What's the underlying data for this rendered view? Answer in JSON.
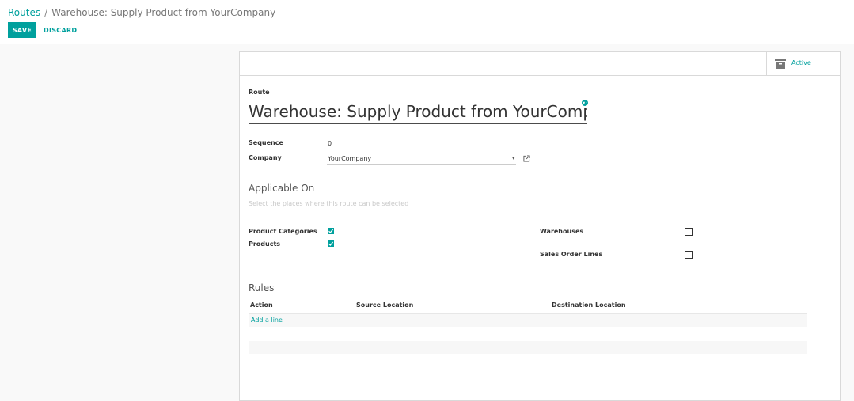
{
  "breadcrumb": {
    "parent": "Routes",
    "separator": "/",
    "current": "Warehouse: Supply Product from YourCompany"
  },
  "toolbar": {
    "save_label": "SAVE",
    "discard_label": "DISCARD"
  },
  "button_box": {
    "active_label": "Active",
    "icon": "archive-icon"
  },
  "form": {
    "route_label": "Route",
    "route_name": "Warehouse: Supply Product from YourCompany",
    "sequence_label": "Sequence",
    "sequence_value": "0",
    "company_label": "Company",
    "company_value": "YourCompany"
  },
  "applicable_on": {
    "title": "Applicable On",
    "help": "Select the places where this route can be selected",
    "product_categories_label": "Product Categories",
    "product_categories_checked": true,
    "products_label": "Products",
    "products_checked": true,
    "warehouses_label": "Warehouses",
    "warehouses_checked": false,
    "sales_order_lines_label": "Sales Order Lines",
    "sales_order_lines_checked": false
  },
  "rules": {
    "title": "Rules",
    "columns": [
      "Action",
      "Source Location",
      "Destination Location"
    ],
    "add_line_label": "Add a line"
  },
  "colors": {
    "accent": "#00a09d",
    "background": "#f9f9f9",
    "sheet": "#ffffff"
  }
}
